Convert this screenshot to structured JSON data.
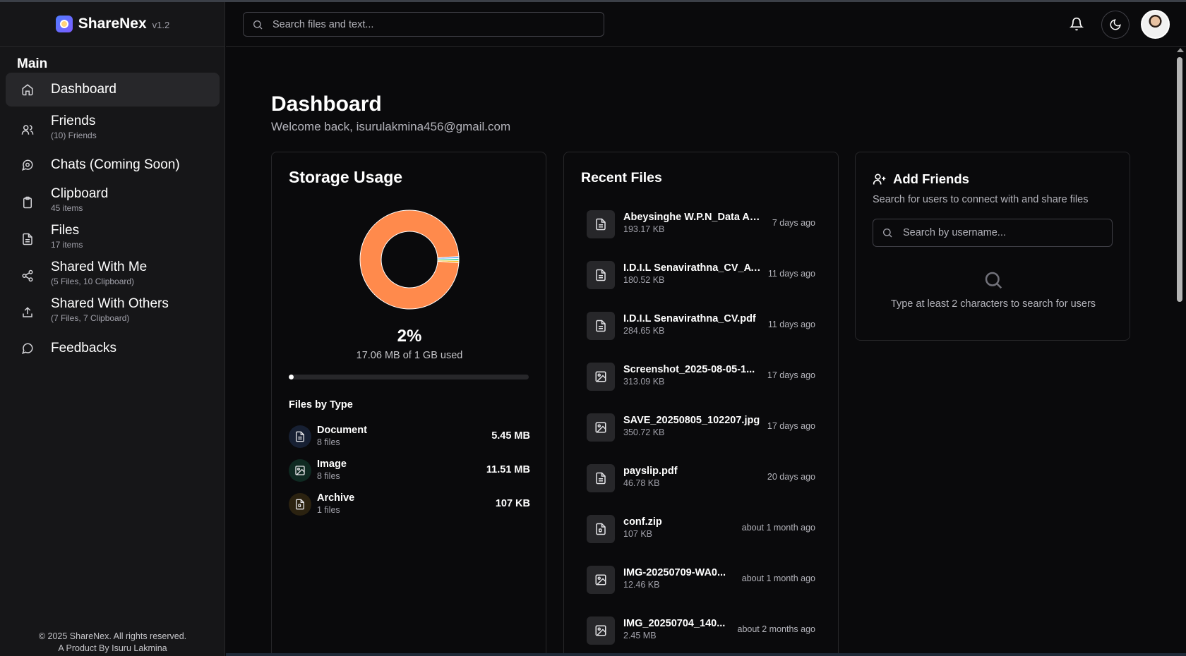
{
  "app": {
    "name": "ShareNex",
    "version": "v1.2"
  },
  "sidebar": {
    "section": "Main",
    "items": [
      {
        "label": "Dashboard",
        "sub": ""
      },
      {
        "label": "Friends",
        "sub": "(10) Friends"
      },
      {
        "label": "Chats (Coming Soon)",
        "sub": ""
      },
      {
        "label": "Clipboard",
        "sub": "45 items"
      },
      {
        "label": "Files",
        "sub": "17 items"
      },
      {
        "label": "Shared With Me",
        "sub": "(5 Files, 10 Clipboard)"
      },
      {
        "label": "Shared With Others",
        "sub": "(7 Files, 7 Clipboard)"
      },
      {
        "label": "Feedbacks",
        "sub": ""
      }
    ],
    "footer": {
      "copyright": "© 2025 ShareNex. All rights reserved.",
      "credit": "A Product By Isuru Lakmina"
    }
  },
  "topbar": {
    "search_placeholder": "Search files and text..."
  },
  "page": {
    "title": "Dashboard",
    "welcome": "Welcome back, isurulakmina456@gmail.com"
  },
  "storage": {
    "title": "Storage Usage",
    "percent": "2%",
    "used_text": "17.06 MB of 1 GB used",
    "progress_fraction": 0.02,
    "files_by_type_title": "Files by Type",
    "types": [
      {
        "name": "Document",
        "count": "8 files",
        "size": "5.45 MB",
        "color": "#60a5fa"
      },
      {
        "name": "Image",
        "count": "8 files",
        "size": "11.51 MB",
        "color": "#34d399"
      },
      {
        "name": "Archive",
        "count": "1 files",
        "size": "107 KB",
        "color": "#fbbf24"
      }
    ],
    "donut": {
      "free_color": "#ff8a4c",
      "free_fraction": 0.98
    }
  },
  "recent": {
    "title": "Recent Files",
    "files": [
      {
        "name": "Abeysinghe W.P.N_Data An...",
        "size": "193.17 KB",
        "date": "7 days ago",
        "icon": "document-icon"
      },
      {
        "name": "I.D.I.L Senavirathna_CV_AT...",
        "size": "180.52 KB",
        "date": "11 days ago",
        "icon": "document-icon"
      },
      {
        "name": "I.D.I.L Senavirathna_CV.pdf",
        "size": "284.65 KB",
        "date": "11 days ago",
        "icon": "document-icon"
      },
      {
        "name": "Screenshot_2025-08-05-1...",
        "size": "313.09 KB",
        "date": "17 days ago",
        "icon": "image-icon"
      },
      {
        "name": "SAVE_20250805_102207.jpg",
        "size": "350.72 KB",
        "date": "17 days ago",
        "icon": "image-icon"
      },
      {
        "name": "payslip.pdf",
        "size": "46.78 KB",
        "date": "20 days ago",
        "icon": "document-icon"
      },
      {
        "name": "conf.zip",
        "size": "107 KB",
        "date": "about 1 month ago",
        "icon": "archive-icon"
      },
      {
        "name": "IMG-20250709-WA0...",
        "size": "12.46 KB",
        "date": "about 1 month ago",
        "icon": "image-icon"
      },
      {
        "name": "IMG_20250704_140...",
        "size": "2.45 MB",
        "date": "about 2 months ago",
        "icon": "image-icon"
      }
    ]
  },
  "friends": {
    "title": "Add Friends",
    "subtitle": "Search for users to connect with and share files",
    "search_placeholder": "Search by username...",
    "hint": "Type at least 2 characters to search for users"
  }
}
